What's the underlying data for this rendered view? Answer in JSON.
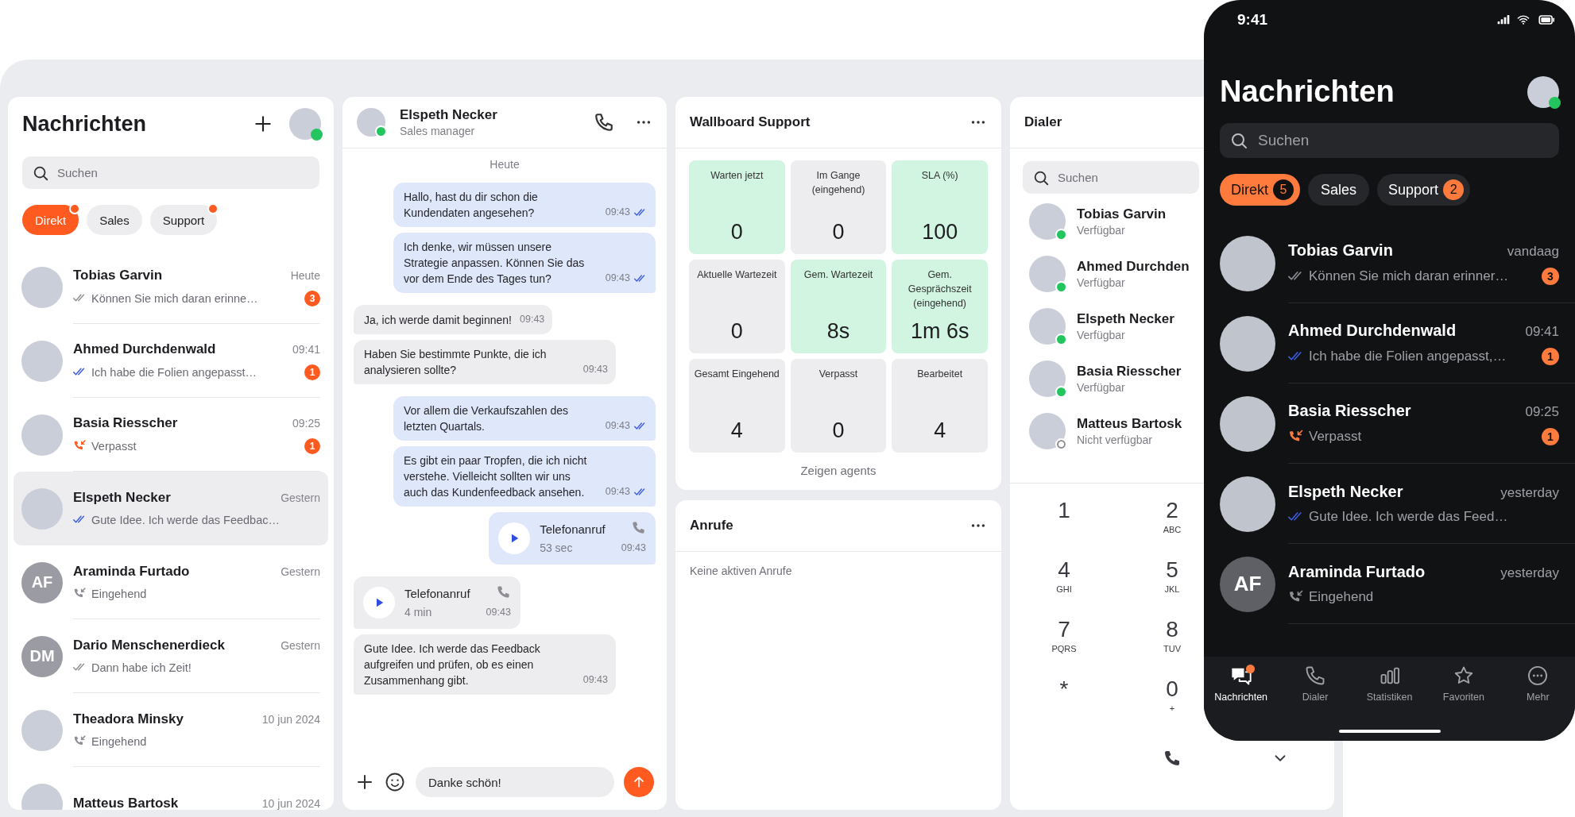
{
  "inbox": {
    "title": "Nachrichten",
    "user": {
      "online": true
    },
    "search": {
      "placeholder": "Suchen"
    },
    "filters": [
      {
        "label": "Direkt",
        "selected": true,
        "unread": true
      },
      {
        "label": "Sales",
        "selected": false,
        "unread": false
      },
      {
        "label": "Support",
        "selected": false,
        "unread": true
      }
    ],
    "conversations": [
      {
        "name": "Tobias Garvin",
        "time": "Heute",
        "kind": "delivered",
        "preview": "Können Sie mich daran erinne…",
        "unread_count": "3",
        "selected": false
      },
      {
        "name": "Ahmed Durchdenwald",
        "time": "09:41",
        "kind": "read",
        "preview": "Ich habe die Folien angepasst…",
        "unread_count": "1",
        "selected": false
      },
      {
        "name": "Basia Riesscher",
        "time": "09:25",
        "kind": "missed",
        "preview": "Verpasst",
        "unread_count": "1",
        "selected": false
      },
      {
        "name": "Elspeth Necker",
        "time": "Gestern",
        "kind": "read",
        "preview": "Gute Idee. Ich werde das Feedbac…",
        "selected": true
      },
      {
        "name": "Araminda Furtado",
        "time": "Gestern",
        "initials": "AF",
        "kind": "incoming",
        "preview": "Eingehend",
        "selected": false
      },
      {
        "name": "Dario Menschenerdieck",
        "time": "Gestern",
        "initials": "DM",
        "kind": "delivered",
        "preview": "Dann habe ich Zeit!",
        "selected": false
      },
      {
        "name": "Theadora Minsky",
        "time": "10 jun 2024",
        "kind": "incoming",
        "preview": "Eingehend",
        "selected": false
      },
      {
        "name": "Matteus Bartosk",
        "time": "10 jun 2024",
        "selected": false
      }
    ]
  },
  "chat": {
    "contact": {
      "name": "Elspeth Necker",
      "subtitle": "Sales manager",
      "online": true
    },
    "date_divider": "Heute",
    "messages": [
      {
        "outgoing": true,
        "kind": "text",
        "text": "Hallo, hast du dir schon die Kundendaten angesehen?",
        "time": "09:43",
        "read": true
      },
      {
        "outgoing": true,
        "kind": "text",
        "text": "Ich denke, wir müssen unsere Strategie anpassen. Können Sie das vor dem Ende des Tages tun?",
        "time": "09:43",
        "read": true
      },
      {
        "outgoing": false,
        "kind": "text",
        "text": "Ja, ich werde damit beginnen!",
        "time": "09:43"
      },
      {
        "outgoing": false,
        "kind": "text",
        "text": "Haben Sie bestimmte Punkte, die ich analysieren sollte?",
        "time": "09:43"
      },
      {
        "outgoing": true,
        "kind": "text",
        "text": "Vor allem die Verkaufszahlen des letzten Quartals.",
        "time": "09:43",
        "read": true
      },
      {
        "outgoing": true,
        "kind": "text",
        "text": "Es gibt ein paar Tropfen, die ich nicht verstehe. Vielleicht sollten wir uns auch das Kundenfeedback ansehen.",
        "time": "09:43",
        "read": true
      },
      {
        "outgoing": true,
        "kind": "call",
        "title": "Telefonanruf",
        "duration": "53 sec",
        "time": "09:43"
      },
      {
        "outgoing": false,
        "kind": "call",
        "title": "Telefonanruf",
        "duration": "4 min",
        "time": "09:43"
      },
      {
        "outgoing": false,
        "kind": "text",
        "text": "Gute Idee. Ich werde das Feedback aufgreifen und prüfen, ob es einen Zusammenhang gibt.",
        "time": "09:43"
      }
    ],
    "composer": {
      "value": "Danke schön!"
    }
  },
  "wallboard": {
    "title": "Wallboard Support",
    "metrics": [
      {
        "label": "Warten jetzt",
        "value": "0",
        "highlighted": true
      },
      {
        "label": "Im Gange (eingehend)",
        "value": "0",
        "highlighted": false
      },
      {
        "label": "SLA (%)",
        "value": "100",
        "highlighted": true
      },
      {
        "label": "Aktuelle Wartezeit",
        "value": "0",
        "highlighted": false
      },
      {
        "label": "Gem. Wartezeit",
        "value": "8s",
        "highlighted": true
      },
      {
        "label": "Gem. Gesprächszeit (eingehend)",
        "value": "1m 6s",
        "highlighted": true
      },
      {
        "label": "Gesamt Eingehend",
        "value": "4",
        "highlighted": false
      },
      {
        "label": "Verpasst",
        "value": "0",
        "highlighted": false
      },
      {
        "label": "Bearbeitet",
        "value": "4",
        "highlighted": false
      }
    ],
    "link": "Zeigen agents"
  },
  "calls": {
    "title": "Anrufe",
    "empty_text": "Keine aktiven Anrufe"
  },
  "dialer": {
    "title": "Dialer",
    "search": {
      "placeholder": "Suchen"
    },
    "contacts": [
      {
        "name": "Tobias Garvin",
        "status": "Verfügbar",
        "available": true
      },
      {
        "name": "Ahmed Durchden",
        "status": "Verfügbar",
        "available": true
      },
      {
        "name": "Elspeth Necker",
        "status": "Verfügbar",
        "available": true
      },
      {
        "name": "Basia Riesscher",
        "status": "Verfügbar",
        "available": true
      },
      {
        "name": "Matteus Bartosk",
        "status": "Nicht verfügbar",
        "available": false
      }
    ],
    "keys": [
      {
        "digit": "1"
      },
      {
        "digit": "2",
        "letters": "ABC"
      },
      {
        "digit": "4",
        "letters": "GHI"
      },
      {
        "digit": "5",
        "letters": "JKL"
      },
      {
        "digit": "7",
        "letters": "PQRS"
      },
      {
        "digit": "8",
        "letters": "TUV"
      },
      {
        "digit": "*"
      },
      {
        "digit": "0",
        "letters": "+"
      }
    ]
  },
  "phone": {
    "status_bar": {
      "time": "9:41"
    },
    "title": "Nachrichten",
    "user": {
      "online": true
    },
    "search": {
      "placeholder": "Suchen"
    },
    "filters": [
      {
        "label": "Direkt",
        "selected": true,
        "count": "5"
      },
      {
        "label": "Sales",
        "selected": false
      },
      {
        "label": "Support",
        "selected": false,
        "count": "2"
      }
    ],
    "conversations": [
      {
        "name": "Tobias Garvin",
        "time": "vandaag",
        "kind": "delivered",
        "preview": "Können Sie mich daran erinner…",
        "unread_count": "3",
        "selected": false
      },
      {
        "name": "Ahmed Durchdenwald",
        "time": "09:41",
        "kind": "read",
        "preview": "Ich habe die Folien angepasst,…",
        "unread_count": "1",
        "selected": false
      },
      {
        "name": "Basia Riesscher",
        "time": "09:25",
        "kind": "missed",
        "preview": "Verpasst",
        "unread_count": "1",
        "selected": false
      },
      {
        "name": "Elspeth Necker",
        "time": "yesterday",
        "kind": "read",
        "preview": "Gute Idee. Ich werde das Feed…",
        "selected": false
      },
      {
        "name": "Araminda Furtado",
        "time": "yesterday",
        "initials": "AF",
        "kind": "incoming",
        "preview": "Eingehend",
        "selected": false
      }
    ],
    "tab_bar": [
      {
        "label": "Nachrichten",
        "selected": true,
        "badge": true
      },
      {
        "label": "Dialer",
        "selected": false,
        "badge": false
      },
      {
        "label": "Statistiken",
        "selected": false,
        "badge": false
      },
      {
        "label": "Favoriten",
        "selected": false,
        "badge": false
      },
      {
        "label": "Mehr",
        "selected": false,
        "badge": false
      }
    ]
  }
}
